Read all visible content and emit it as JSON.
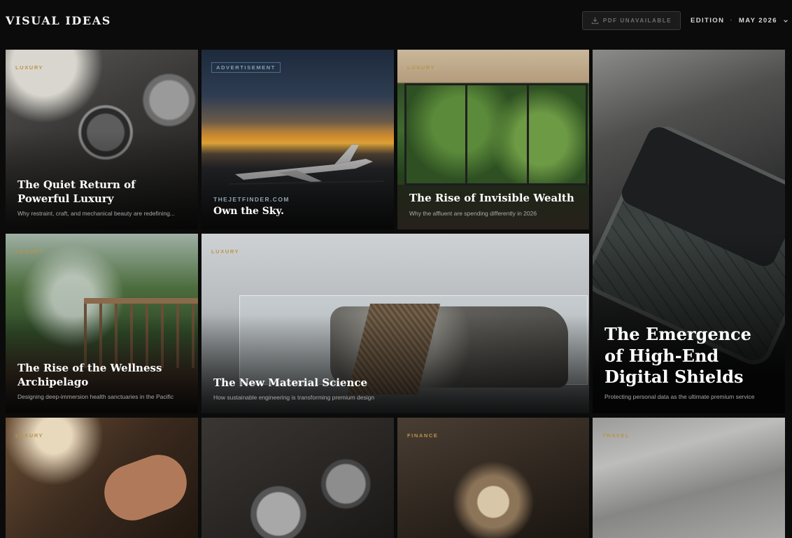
{
  "header": {
    "brand": "VISUAL IDEAS",
    "pdf_button": "PDF UNAVAILABLE",
    "edition_label": "EDITION",
    "edition_separator": "·",
    "edition_value": "MAY 2026"
  },
  "tiles": [
    {
      "category": "LUXURY",
      "title": "The Quiet Return of Powerful Luxury",
      "subtitle": "Why restraint, craft, and mechanical beauty are redefining..."
    },
    {
      "badge": "ADVERTISEMENT",
      "sponsor": "THEJETFINDER.COM",
      "title": "Own the Sky."
    },
    {
      "category": "LUXURY",
      "title": "The Rise of Invisible Wealth",
      "subtitle": "Why the affluent are spending differently in 2026"
    },
    {
      "title": "The Emergence of High-End Digital Shields",
      "subtitle": "Protecting personal data as the ultimate premium service"
    },
    {
      "category": "LUXURY",
      "title": "The Rise of the Wellness Archipelago",
      "subtitle": "Designing deep-immersion health sanctuaries in the Pacific"
    },
    {
      "category": "LUXURY",
      "title": "The New Material Science",
      "subtitle": "How sustainable engineering is transforming premium design"
    },
    {
      "category": "LUXURY"
    },
    {
      "category": ""
    },
    {
      "category": "FINANCE"
    },
    {
      "category": "TRAVEL"
    }
  ],
  "icons": {
    "download": "download-icon",
    "chevron": "chevron-down-icon"
  },
  "colors": {
    "background": "#0b0b0b",
    "category_gold": "#b8944a",
    "ad_blue": "#7fa3b8"
  }
}
